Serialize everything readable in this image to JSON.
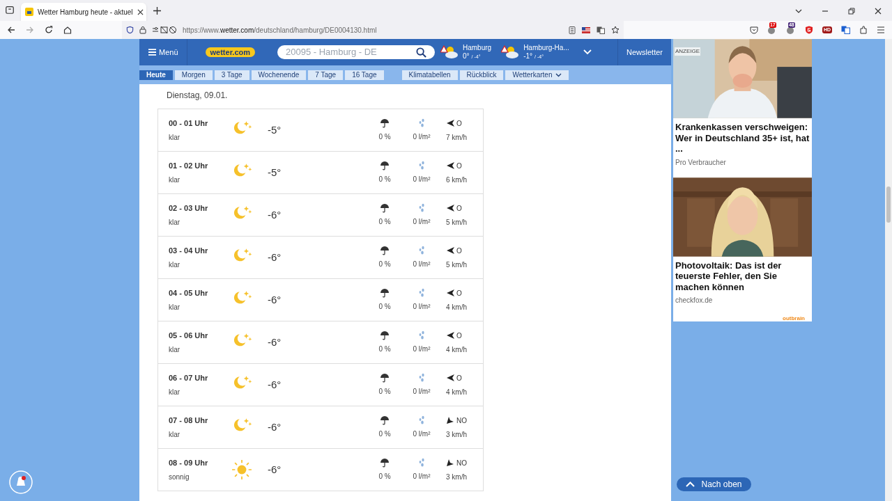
{
  "browser": {
    "tab_title": "Wetter Hamburg heute - aktuel",
    "url_prefix": "https://www.",
    "url_host": "wetter.com",
    "url_path": "/deutschland/hamburg/DE0004130.html",
    "badges": [
      "17",
      "48"
    ],
    "hd_label": "HD"
  },
  "header": {
    "menu": "Menü",
    "logo": "wetter.com",
    "search_placeholder": "20095 - Hamburg - DE",
    "places": [
      {
        "name": "Hamburg",
        "temp": "0°",
        "low": "/ -4°"
      },
      {
        "name": "Hamburg-Ha...",
        "temp": "-1°",
        "low": "/ -4°"
      }
    ],
    "newsletter": "Newsletter"
  },
  "tabs": [
    {
      "label": "Heute",
      "selected": true
    },
    {
      "label": "Morgen",
      "selected": false
    },
    {
      "label": "3 Tage",
      "selected": false
    },
    {
      "label": "Wochenende",
      "selected": false
    },
    {
      "label": "7 Tage",
      "selected": false
    },
    {
      "label": "16 Tage",
      "selected": false
    }
  ],
  "links": [
    {
      "label": "Klimatabellen",
      "kind": "link",
      "selected": false
    },
    {
      "label": "Rückblick",
      "kind": "link",
      "selected": false
    },
    {
      "label": "Wetterkarten",
      "kind": "dropdown",
      "selected": false
    }
  ],
  "date": "Dienstag, 09.01.",
  "rows": [
    {
      "time": "00 - 01 Uhr",
      "condition": "klar",
      "kind": "moon",
      "temp": "-5°",
      "chance": "0 %",
      "amount": "0 l/m²",
      "wind": {
        "kind": "left",
        "direction": "O",
        "speed": "7 km/h"
      }
    },
    {
      "time": "01 - 02 Uhr",
      "condition": "klar",
      "kind": "moon",
      "temp": "-5°",
      "chance": "0 %",
      "amount": "0 l/m²",
      "wind": {
        "kind": "left",
        "direction": "O",
        "speed": "6 km/h"
      }
    },
    {
      "time": "02 - 03 Uhr",
      "condition": "klar",
      "kind": "moon",
      "temp": "-6°",
      "chance": "0 %",
      "amount": "0 l/m²",
      "wind": {
        "kind": "left",
        "direction": "O",
        "speed": "5 km/h"
      }
    },
    {
      "time": "03 - 04 Uhr",
      "condition": "klar",
      "kind": "moon",
      "temp": "-6°",
      "chance": "0 %",
      "amount": "0 l/m²",
      "wind": {
        "kind": "left",
        "direction": "O",
        "speed": "5 km/h"
      }
    },
    {
      "time": "04 - 05 Uhr",
      "condition": "klar",
      "kind": "moon",
      "temp": "-6°",
      "chance": "0 %",
      "amount": "0 l/m²",
      "wind": {
        "kind": "left",
        "direction": "O",
        "speed": "4 km/h"
      }
    },
    {
      "time": "05 - 06 Uhr",
      "condition": "klar",
      "kind": "moon",
      "temp": "-6°",
      "chance": "0 %",
      "amount": "0 l/m²",
      "wind": {
        "kind": "left",
        "direction": "O",
        "speed": "4 km/h"
      }
    },
    {
      "time": "06 - 07 Uhr",
      "condition": "klar",
      "kind": "moon",
      "temp": "-6°",
      "chance": "0 %",
      "amount": "0 l/m²",
      "wind": {
        "kind": "left",
        "direction": "O",
        "speed": "4 km/h"
      }
    },
    {
      "time": "07 - 08 Uhr",
      "condition": "klar",
      "kind": "moon",
      "temp": "-6°",
      "chance": "0 %",
      "amount": "0 l/m²",
      "wind": {
        "kind": "down-left",
        "direction": "NO",
        "speed": "3 km/h"
      }
    },
    {
      "time": "08 - 09 Uhr",
      "condition": "sonnig",
      "kind": "sun",
      "temp": "-6°",
      "chance": "0 %",
      "amount": "0 l/m²",
      "wind": {
        "kind": "down-left",
        "direction": "NO",
        "speed": "3 km/h"
      }
    }
  ],
  "ads": {
    "label": "ANZEIGE",
    "items": [
      {
        "headline": "Krankenkassen verschweigen: Wer in Deutschland 35+ ist, hat ...",
        "source": "Pro Verbraucher",
        "kind": "picture"
      },
      {
        "headline": "Photovoltaik: Das ist der teuerste Fehler, den Sie machen können",
        "source": "checkfox.de",
        "kind": "picture"
      }
    ],
    "network": "outbrain"
  },
  "back_to_top": "Nach oben"
}
